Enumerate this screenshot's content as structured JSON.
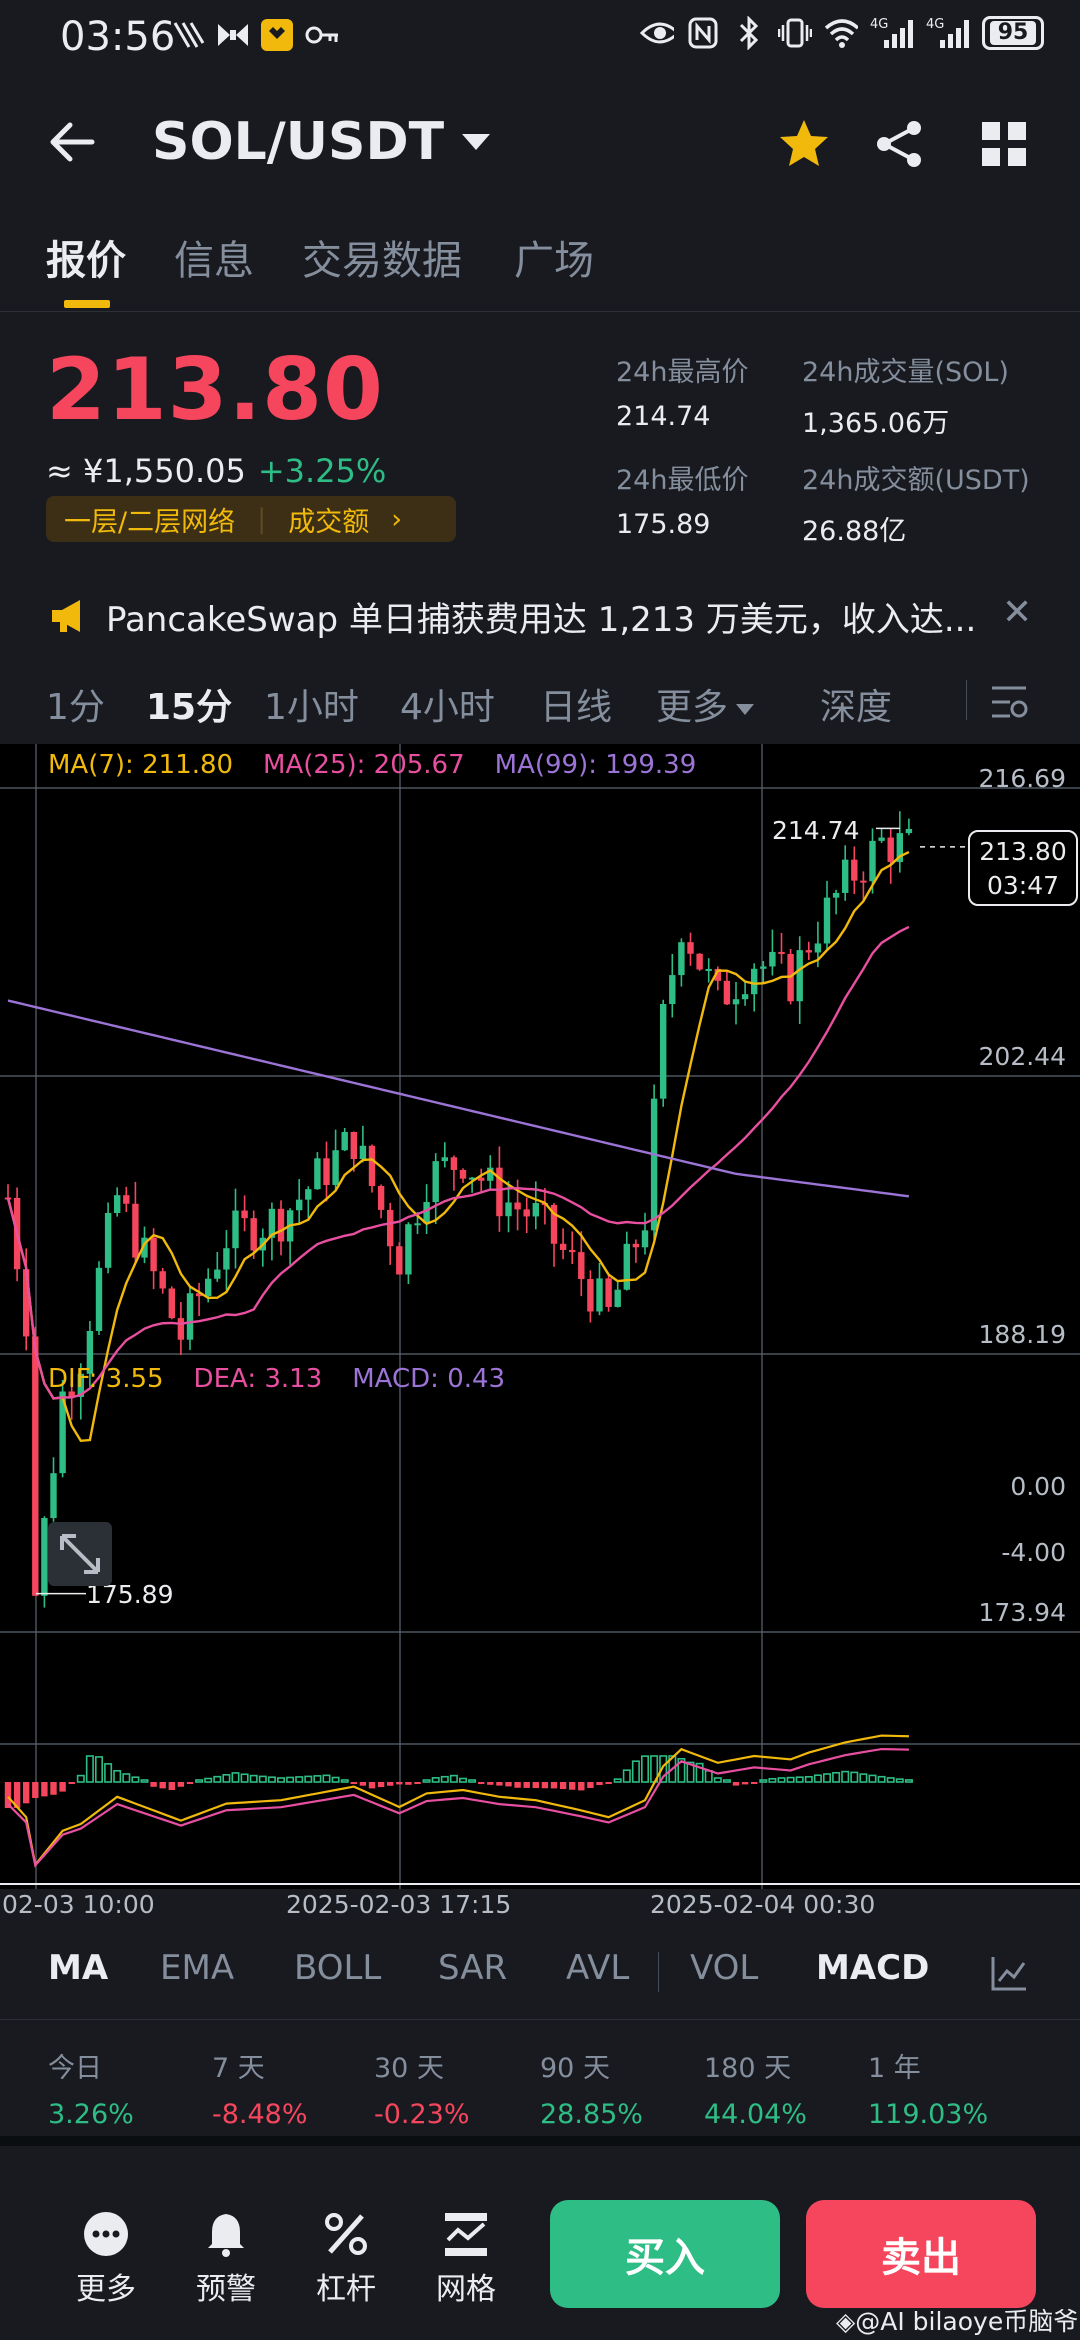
{
  "status_bar": {
    "time": "03:56",
    "net1": "4G",
    "net2": "4G",
    "battery": "95"
  },
  "header": {
    "pair": "SOL/USDT"
  },
  "tabs": [
    "报价",
    "信息",
    "交易数据",
    "广场"
  ],
  "summary": {
    "price": "213.80",
    "fiat": "≈ ¥1,550.05",
    "change": "+3.25%",
    "tag1": "一层/二层网络",
    "tag2": "成交额",
    "high_label": "24h最高价",
    "high": "214.74",
    "vol_label": "24h成交量(SOL)",
    "vol": "1,365.06万",
    "low_label": "24h最低价",
    "low": "175.89",
    "amt_label": "24h成交额(USDT)",
    "amt": "26.88亿"
  },
  "news": {
    "text": "PancakeSwap 单日捕获费用达 1,213 万美元，收入达..."
  },
  "intervals": [
    "1分",
    "15分",
    "1小时",
    "4小时",
    "日线",
    "更多",
    "深度"
  ],
  "chart_data": {
    "type": "candlestick",
    "ma_legend": {
      "ma7": "MA(7): 211.80",
      "ma25": "MA(25): 205.67",
      "ma99": "MA(99): 199.39"
    },
    "y_ticks": [
      "216.69",
      "202.44",
      "188.19",
      "173.94"
    ],
    "macd_legend": {
      "dif": "DIF: 3.55",
      "dea": "DEA: 3.13",
      "macd": "MACD: 0.43"
    },
    "macd_ticks": [
      "0.00",
      "-4.00"
    ],
    "x_ticks": [
      "02-03 10:00",
      "2025-02-03 17:15",
      "2025-02-04 00:30"
    ],
    "ylim": [
      173.94,
      216.69
    ],
    "last_price": "213.80",
    "countdown": "03:47",
    "high_ann": "214.74",
    "low_ann": "175.89",
    "colors": {
      "up": "#2ebd85",
      "down": "#f6465d",
      "ma7": "#f0b90b",
      "ma25": "#e84fa0",
      "ma99": "#9b74d6"
    }
  },
  "indicators": [
    "MA",
    "EMA",
    "BOLL",
    "SAR",
    "AVL",
    "VOL",
    "MACD"
  ],
  "performance": [
    {
      "label": "今日",
      "value": "3.26%",
      "dir": "up"
    },
    {
      "label": "7 天",
      "value": "-8.48%",
      "dir": "down"
    },
    {
      "label": "30 天",
      "value": "-0.23%",
      "dir": "down"
    },
    {
      "label": "90 天",
      "value": "28.85%",
      "dir": "up"
    },
    {
      "label": "180 天",
      "value": "44.04%",
      "dir": "up"
    },
    {
      "label": "1 年",
      "value": "119.03%",
      "dir": "up"
    }
  ],
  "bottom": {
    "more": "更多",
    "alert": "预警",
    "leverage": "杠杆",
    "grid": "网格",
    "buy": "买入",
    "sell": "卖出"
  },
  "watermark": "@AI bilaoye币脑爷"
}
